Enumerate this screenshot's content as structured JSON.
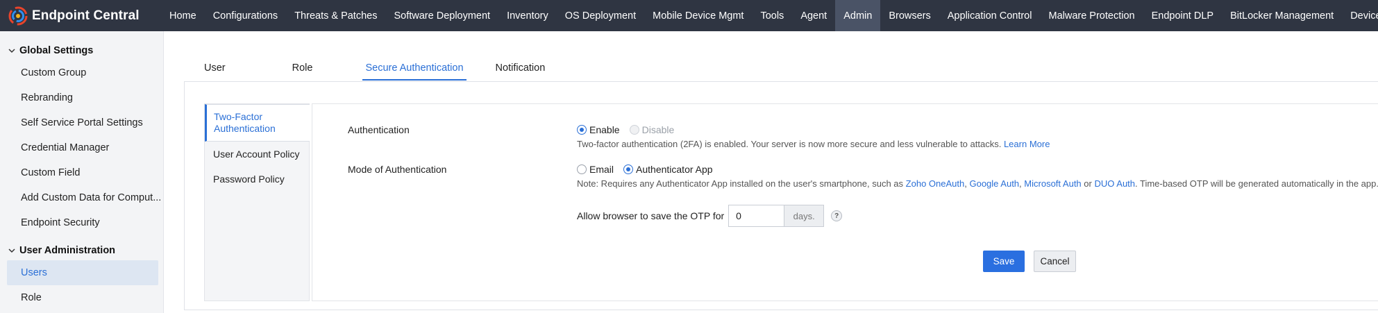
{
  "brand": {
    "name": "Endpoint Central"
  },
  "nav": {
    "items": [
      {
        "label": "Home"
      },
      {
        "label": "Configurations"
      },
      {
        "label": "Threats & Patches"
      },
      {
        "label": "Software Deployment"
      },
      {
        "label": "Inventory"
      },
      {
        "label": "OS Deployment"
      },
      {
        "label": "Mobile Device Mgmt"
      },
      {
        "label": "Tools"
      },
      {
        "label": "Agent"
      },
      {
        "label": "Admin"
      },
      {
        "label": "Browsers"
      },
      {
        "label": "Application Control"
      },
      {
        "label": "Malware Protection"
      },
      {
        "label": "Endpoint DLP"
      },
      {
        "label": "BitLocker Management"
      },
      {
        "label": "Device Control"
      }
    ],
    "active": "Admin"
  },
  "sidebar": {
    "sections": [
      {
        "title": "Global Settings",
        "items": [
          {
            "label": "Custom Group"
          },
          {
            "label": "Rebranding"
          },
          {
            "label": "Self Service Portal Settings"
          },
          {
            "label": "Credential Manager"
          },
          {
            "label": "Custom Field"
          },
          {
            "label": "Add Custom Data for Comput..."
          },
          {
            "label": "Endpoint Security"
          }
        ]
      },
      {
        "title": "User Administration",
        "items": [
          {
            "label": "Users"
          },
          {
            "label": "Role"
          }
        ]
      }
    ],
    "active": "Users"
  },
  "tabs": [
    {
      "label": "User"
    },
    {
      "label": "Role"
    },
    {
      "label": "Secure Authentication"
    },
    {
      "label": "Notification"
    }
  ],
  "active_tab": "Secure Authentication",
  "subnav": {
    "items": [
      {
        "label": "Two-Factor Authentication"
      },
      {
        "label": "User Account Policy"
      },
      {
        "label": "Password Policy"
      }
    ],
    "active": "Two-Factor Authentication"
  },
  "form": {
    "authentication": {
      "label": "Authentication",
      "enable_label": "Enable",
      "disable_label": "Disable",
      "selected": "Enable",
      "note": "Two-factor authentication (2FA) is enabled. Your server is now more secure and less vulnerable to attacks.",
      "learn_more": "Learn More"
    },
    "mode": {
      "label": "Mode of Authentication",
      "email_label": "Email",
      "app_label": "Authenticator App",
      "selected": "Authenticator App",
      "note_prefix": "Note: Requires any Authenticator App installed on the user's smartphone, such as",
      "link_zoho": "Zoho OneAuth",
      "sep1": ",",
      "link_google": "Google Auth",
      "sep2": ",",
      "link_microsoft": "Microsoft Auth",
      "or": "or",
      "link_duo": "DUO Auth",
      "note_suffix": ". Time-based OTP will be generated automatically in the app."
    },
    "otp": {
      "label": "Allow browser to save the OTP for",
      "value": "0",
      "unit": "days.",
      "help": "?"
    },
    "save_label": "Save",
    "cancel_label": "Cancel"
  },
  "colors": {
    "topbar": "#2f3542",
    "accent": "#2a6fd6",
    "sidebar_bg": "#f3f4f6"
  }
}
